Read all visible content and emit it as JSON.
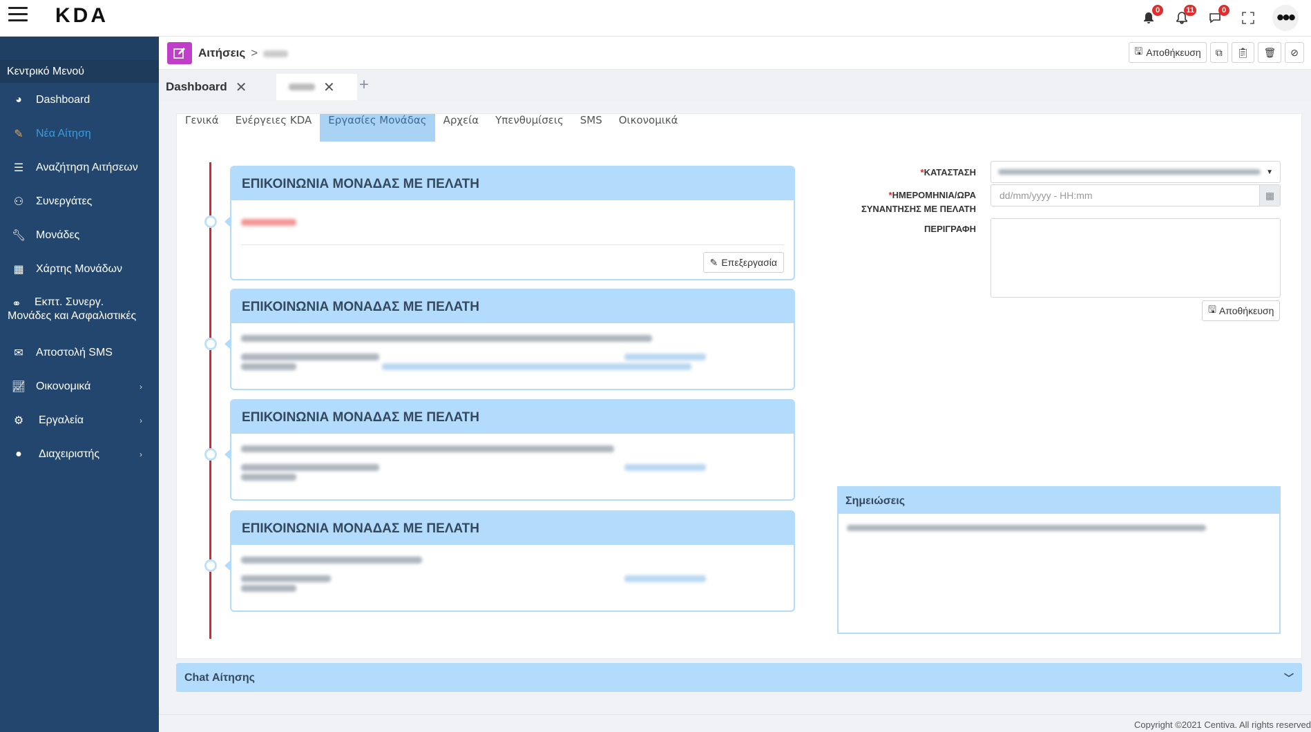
{
  "header": {
    "logo": "KDA",
    "notifications": [
      {
        "icon": "bell-icon",
        "count": "0"
      },
      {
        "icon": "alert-bell-icon",
        "count": "11"
      },
      {
        "icon": "chat-bubble-icon",
        "count": "0"
      }
    ]
  },
  "sidebar": {
    "title": "Κεντρικό Μενού",
    "items": [
      {
        "label": "Dashboard",
        "icon": "dashboard-gauge-icon"
      },
      {
        "label": "Νέα Αίτηση",
        "icon": "edit-icon"
      },
      {
        "label": "Αναζήτηση Αιτήσεων",
        "icon": "list-icon"
      },
      {
        "label": "Συνεργάτες",
        "icon": "user-icon"
      },
      {
        "label": "Μονάδες",
        "icon": "wrench-icon"
      },
      {
        "label": "Χάρτης Μονάδων",
        "icon": "map-icon"
      },
      {
        "label": "Εκπτ. Συνεργ. Μονάδες και Ασφαλιστικές",
        "label_line1": "Εκπτ. Συνεργ.",
        "label_line2": "Μονάδες και Ασφαλιστικές",
        "icon": "handshake-icon"
      },
      {
        "label": "Αποστολή SMS",
        "icon": "envelope-icon"
      },
      {
        "label": "Οικονομικά",
        "icon": "line-chart-icon"
      },
      {
        "label": "Εργαλεία",
        "icon": "cogs-icon"
      },
      {
        "label": "Διαχειριστής",
        "icon": "user-circle-icon"
      }
    ]
  },
  "breadcrumb": {
    "section": "Αιτήσεις",
    "separator": ">"
  },
  "toolbar": {
    "save_label": "Αποθήκευση"
  },
  "doc_tabs": [
    {
      "label": "Dashboard"
    }
  ],
  "subtabs": [
    "Γενικά",
    "Ενέργειες KDA",
    "Εργασίες Μονάδας",
    "Αρχεία",
    "Υπενθυμίσεις",
    "SMS",
    "Οικονομικά"
  ],
  "timeline": {
    "card_title": "ΕΠΙΚΟΙΝΩΝΙΑ ΜΟΝΑΔΑΣ ΜΕ ΠΕΛΑΤΗ",
    "edit_label": "Επεξεργασία"
  },
  "form": {
    "status_label": "ΚΑΤΑΣΤΑΣΗ",
    "date_label_line1": "ΗΜΕΡΟΜΗΝΙΑ/ΩΡΑ",
    "date_label_line2": "ΣΥΝΑΝΤΗΣΗΣ ΜΕ ΠΕΛΑΤΗ",
    "date_placeholder": "dd/mm/yyyy - HH:mm",
    "description_label": "ΠΕΡΙΓΡΑΦΗ",
    "save_label": "Αποθήκευση",
    "required_mark": "*"
  },
  "notes": {
    "title": "Σημειώσεις"
  },
  "chat": {
    "title": "Chat Αίτησης"
  },
  "footer": {
    "copyright": "Copyright ©2021 Centiva. All rights reserved"
  },
  "colors": {
    "sidebar": "#22466d",
    "accent": "#b3dbfb",
    "active_link": "#3a9ce0",
    "timeline": "#e0212e",
    "badge": "#e02d2d",
    "crumb_icon": "#c03fc8"
  }
}
